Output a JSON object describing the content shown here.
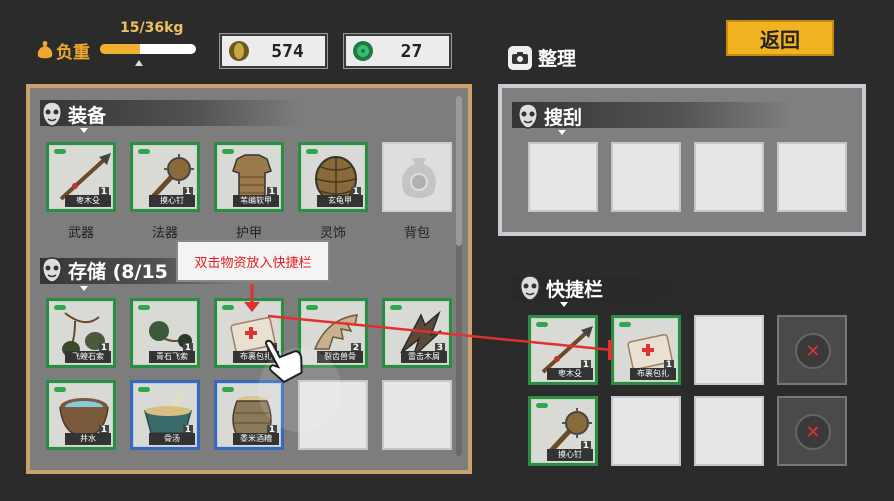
{
  "weight": {
    "label": "负重",
    "value": "15/36kg",
    "fraction": 0.4167
  },
  "currency": {
    "gold": "574",
    "jade": "27"
  },
  "back_button": "返回",
  "sort_button": "整理",
  "equipment": {
    "title": "装备",
    "slots": [
      {
        "label": "武器",
        "item": "枣木殳",
        "count": "1"
      },
      {
        "label": "法器",
        "item": "摸心钉",
        "count": "1"
      },
      {
        "label": "护甲",
        "item": "苇编软甲",
        "count": "1"
      },
      {
        "label": "灵饰",
        "item": "玄龟甲",
        "count": "1"
      },
      {
        "label": "背包",
        "item": "",
        "count": ""
      }
    ]
  },
  "storage": {
    "title": "存储（8/15）",
    "title_visible": "存储 (8/15",
    "items": [
      {
        "name": "飞蝗石索",
        "count": "1"
      },
      {
        "name": "青石飞索",
        "count": "1"
      },
      {
        "name": "布裹包扎",
        "count": "1"
      },
      {
        "name": "裂齿兽骨",
        "count": "2"
      },
      {
        "name": "雷击木屑",
        "count": "3"
      },
      {
        "name": "井水",
        "count": "1"
      },
      {
        "name": "骨汤",
        "count": "1"
      },
      {
        "name": "黍米酒糟",
        "count": "1"
      }
    ]
  },
  "hint_text": "双击物资放入快捷栏",
  "loot": {
    "title": "搜刮"
  },
  "quickbar": {
    "title": "快捷栏",
    "items": [
      {
        "name": "枣木殳",
        "count": "1"
      },
      {
        "name": "布裹包扎",
        "count": "1"
      },
      {
        "name": "摸心钉",
        "count": "1"
      }
    ]
  },
  "colors": {
    "accent": "#f2b320",
    "equip_border": "#2f8a45",
    "rare_border": "#3a68b8",
    "hint_text": "#e02020"
  },
  "icons": [
    "weight-icon",
    "coin-icon",
    "jade-icon",
    "camera-icon",
    "mask-icon",
    "hand-pointer-icon",
    "remove-icon"
  ]
}
